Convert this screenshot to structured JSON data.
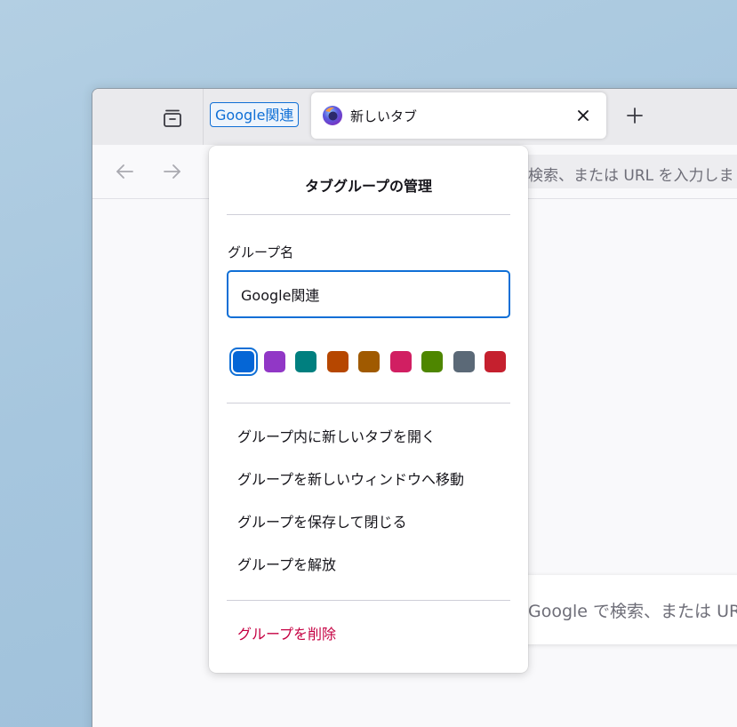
{
  "tabbar": {
    "group_label": "Google関連",
    "tab": {
      "title": "新しいタブ"
    }
  },
  "navbar": {
    "url_placeholder": "検索、または URL を入力しま"
  },
  "newtab": {
    "search_placeholder": "Google で検索、または UR"
  },
  "panel": {
    "title": "タブグループの管理",
    "name_label": "グループ名",
    "name_value": "Google関連",
    "colors": [
      "#0566d6",
      "#9137c6",
      "#007f7f",
      "#b64700",
      "#a05a00",
      "#d11f62",
      "#4e8600",
      "#5b6977",
      "#c5202e"
    ],
    "selected_color": "#0566d6",
    "menu": {
      "open_tab": "グループ内に新しいタブを開く",
      "move_window": "グループを新しいウィンドウへ移動",
      "save_close": "グループを保存して閉じる",
      "ungroup": "グループを解放",
      "delete": "グループを削除"
    }
  },
  "icons": {
    "tabs_list": "tab-list-icon",
    "favicon": "firefox-logo-icon",
    "close": "close-icon",
    "new_tab": "plus-icon",
    "back": "back-arrow-icon",
    "forward": "forward-arrow-icon"
  }
}
